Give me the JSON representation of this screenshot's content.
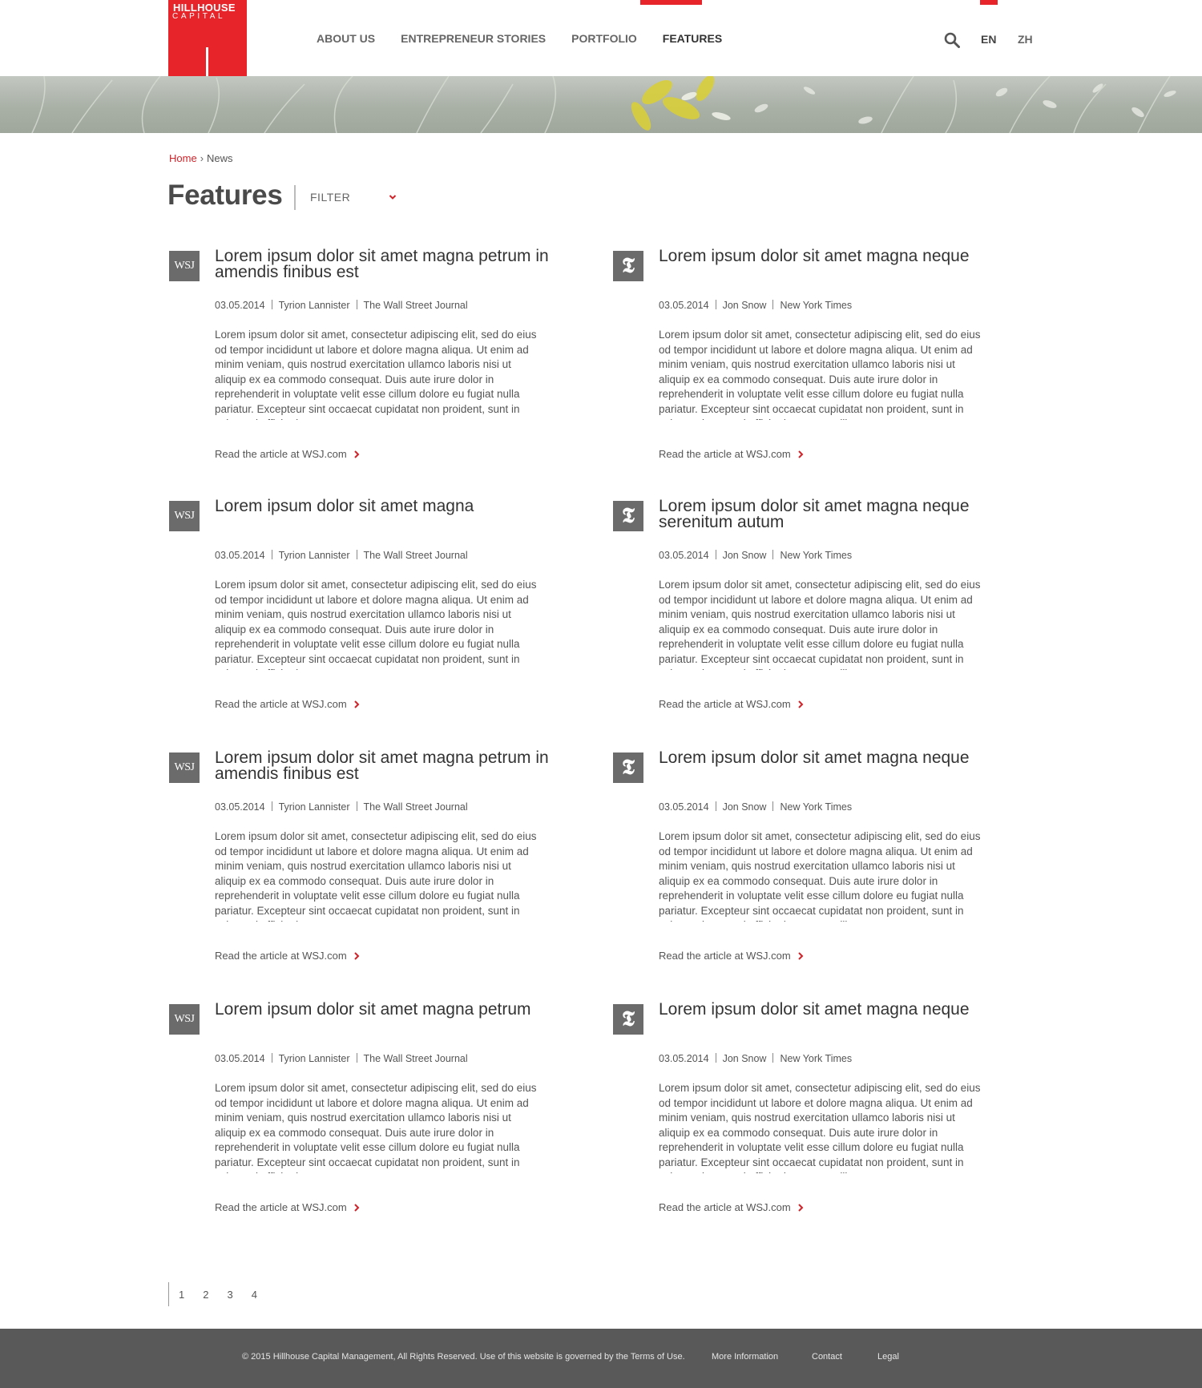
{
  "brand": {
    "line1": "HILLHOUSE",
    "line2": "CAPITAL",
    "color": "#e8242b"
  },
  "nav": [
    {
      "label": "ABOUT US"
    },
    {
      "label": "ENTREPRENEUR STORIES"
    },
    {
      "label": "PORTFOLIO"
    },
    {
      "label": "FEATURES",
      "active": true
    }
  ],
  "lang": {
    "en": "EN",
    "zh": "ZH"
  },
  "icons": {
    "search": "search-icon",
    "filter": "chevron-down-icon",
    "read_more": "chevron-right-icon"
  },
  "breadcrumb": {
    "home": "Home",
    "separator": "›",
    "current": "News"
  },
  "page": {
    "title": "Features",
    "filter_label": "FILTER"
  },
  "articles": [
    {
      "source": "WSJ",
      "title": "Lorem ipsum dolor sit amet magna petrum in amendis finibus est",
      "date": "03.05.2014",
      "author": "Tyrion Lannister",
      "publication": "The Wall Street Journal",
      "excerpt": "Lorem ipsum dolor sit amet, consectetur adipiscing elit, sed do eius od tempor incididunt ut labore et dolore magna aliqua. Ut enim ad minim veniam, quis nostrud exercitation ullamco laboris nisi ut aliquip ex ea commodo consequat. Duis aute irure dolor in reprehenderit in voluptate velit esse cillum dolore eu fugiat nulla pariatur. Excepteur sint occaecat cupidatat non proident, sunt in culpa qui officia deserunt...",
      "link": "Read the article at WSJ.com"
    },
    {
      "source": "NYT",
      "title": "Lorem ipsum dolor sit amet magna neque",
      "date": "03.05.2014",
      "author": "Jon Snow",
      "publication": "New York Times",
      "excerpt": "Lorem ipsum dolor sit amet, consectetur adipiscing elit, sed do eius od tempor incididunt ut labore et dolore magna aliqua. Ut enim ad minim veniam, quis nostrud exercitation ullamco laboris nisi ut aliquip ex ea commodo consequat. Duis aute irure dolor in reprehenderit in voluptate velit esse cillum dolore eu fugiat nulla pariatur. Excepteur sint occaecat cupidatat non proident, sunt in culpa estim un qui officia deserunt mollit...",
      "link": "Read the article at WSJ.com"
    },
    {
      "source": "WSJ",
      "title": "Lorem ipsum dolor sit amet magna",
      "date": "03.05.2014",
      "author": "Tyrion Lannister",
      "publication": "The Wall Street Journal",
      "excerpt": "Lorem ipsum dolor sit amet, consectetur adipiscing elit, sed do eius od tempor incididunt ut labore et dolore magna aliqua. Ut enim ad minim veniam, quis nostrud exercitation ullamco laboris nisi ut aliquip ex ea commodo consequat. Duis aute irure dolor in reprehenderit in voluptate velit esse cillum dolore eu fugiat nulla pariatur. Excepteur sint occaecat cupidatat non proident, sunt in culpa qui officia deserunt...",
      "link": "Read the article at WSJ.com"
    },
    {
      "source": "NYT",
      "title": "Lorem ipsum dolor sit amet magna neque serenitum autum",
      "date": "03.05.2014",
      "author": "Jon Snow",
      "publication": "New York Times",
      "excerpt": "Lorem ipsum dolor sit amet, consectetur adipiscing elit, sed do eius od tempor incididunt ut labore et dolore magna aliqua. Ut enim ad minim veniam, quis nostrud exercitation ullamco laboris nisi ut aliquip ex ea commodo consequat. Duis aute irure dolor in reprehenderit in voluptate velit esse cillum dolore eu fugiat nulla pariatur. Excepteur sint occaecat cupidatat non proident, sunt in culpa estim un qui officia deserunt mollit...",
      "link": "Read the article at WSJ.com"
    },
    {
      "source": "WSJ",
      "title": "Lorem ipsum dolor sit amet magna petrum in amendis finibus est",
      "date": "03.05.2014",
      "author": "Tyrion Lannister",
      "publication": "The Wall Street Journal",
      "excerpt": "Lorem ipsum dolor sit amet, consectetur adipiscing elit, sed do eius od tempor incididunt ut labore et dolore magna aliqua. Ut enim ad minim veniam, quis nostrud exercitation ullamco laboris nisi ut aliquip ex ea commodo consequat. Duis aute irure dolor in reprehenderit in voluptate velit esse cillum dolore eu fugiat nulla pariatur. Excepteur sint occaecat cupidatat non proident, sunt in culpa qui officia deserunt...",
      "link": "Read the article at WSJ.com"
    },
    {
      "source": "NYT",
      "title": "Lorem ipsum dolor sit amet magna neque",
      "date": "03.05.2014",
      "author": "Jon Snow",
      "publication": "New York Times",
      "excerpt": "Lorem ipsum dolor sit amet, consectetur adipiscing elit, sed do eius od tempor incididunt ut labore et dolore magna aliqua. Ut enim ad minim veniam, quis nostrud exercitation ullamco laboris nisi ut aliquip ex ea commodo consequat. Duis aute irure dolor in reprehenderit in voluptate velit esse cillum dolore eu fugiat nulla pariatur. Excepteur sint occaecat cupidatat non proident, sunt in culpa estim un qui officia deserunt mollit...",
      "link": "Read the article at WSJ.com"
    },
    {
      "source": "WSJ",
      "title": "Lorem ipsum dolor sit amet magna petrum",
      "date": "03.05.2014",
      "author": "Tyrion Lannister",
      "publication": "The Wall Street Journal",
      "excerpt": "Lorem ipsum dolor sit amet, consectetur adipiscing elit, sed do eius od tempor incididunt ut labore et dolore magna aliqua. Ut enim ad minim veniam, quis nostrud exercitation ullamco laboris nisi ut aliquip ex ea commodo consequat. Duis aute irure dolor in reprehenderit in voluptate velit esse cillum dolore eu fugiat nulla pariatur. Excepteur sint occaecat cupidatat non proident, sunt in culpa qui officia deserunt...",
      "link": "Read the article at WSJ.com"
    },
    {
      "source": "NYT",
      "title": "Lorem ipsum dolor sit amet magna neque",
      "date": "03.05.2014",
      "author": "Jon Snow",
      "publication": "New York Times",
      "excerpt": "Lorem ipsum dolor sit amet, consectetur adipiscing elit, sed do eius od tempor incididunt ut labore et dolore magna aliqua. Ut enim ad minim veniam, quis nostrud exercitation ullamco laboris nisi ut aliquip ex ea commodo consequat. Duis aute irure dolor in reprehenderit in voluptate velit esse cillum dolore eu fugiat nulla pariatur. Excepteur sint occaecat cupidatat non proident, sunt in culpa estim un qui officia deserunt mollit...",
      "link": "Read the article at WSJ.com"
    }
  ],
  "source_logos": {
    "WSJ": "WSJ",
    "NYT": "𝕿"
  },
  "pagination": [
    "1",
    "2",
    "3",
    "4"
  ],
  "footer": {
    "copyright": "© 2015 Hillhouse Capital Management, All Rights Reserved. Use of this website is governed by the Terms of Use.",
    "more_info": "More Information",
    "contact": "Contact",
    "legal": "Legal"
  }
}
